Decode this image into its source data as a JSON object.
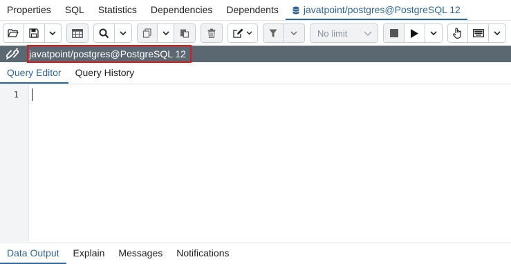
{
  "top_tabs": [
    {
      "label": "Properties"
    },
    {
      "label": "SQL"
    },
    {
      "label": "Statistics"
    },
    {
      "label": "Dependencies"
    },
    {
      "label": "Dependents"
    },
    {
      "label": "javatpoint/postgres@PostgreSQL 12",
      "icon": "database-icon",
      "active": true
    }
  ],
  "toolbar": {
    "limit_select": {
      "value": "No limit"
    },
    "icons": [
      "open-folder-icon",
      "save-icon",
      "chevron-down-icon",
      "table-icon",
      "search-icon",
      "copy-icon",
      "paste-icon",
      "delete-icon",
      "edit-icon",
      "filter-icon",
      "stop-icon",
      "play-icon",
      "hand-icon",
      "keyboard-icon"
    ]
  },
  "connection": {
    "title": "javatpoint/postgres@PostgreSQL 12",
    "icon": "connection-link-icon"
  },
  "editor_tabs": [
    {
      "label": "Query Editor",
      "active": true
    },
    {
      "label": "Query History"
    }
  ],
  "editor": {
    "line_numbers": [
      "1"
    ],
    "content": ""
  },
  "bottom_tabs": [
    {
      "label": "Data Output",
      "active": true
    },
    {
      "label": "Explain"
    },
    {
      "label": "Messages"
    },
    {
      "label": "Notifications"
    }
  ],
  "colors": {
    "accent": "#326690",
    "connection_bar": "#5b6872",
    "highlight_border": "#e0181e"
  }
}
